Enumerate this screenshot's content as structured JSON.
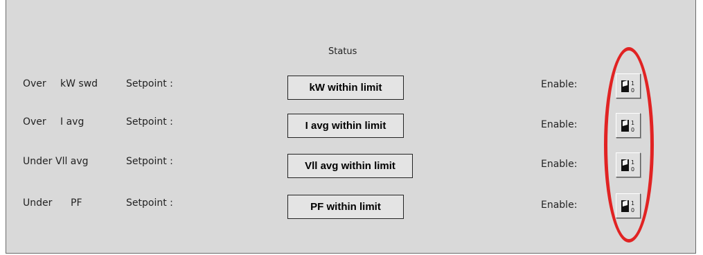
{
  "status_header": "Status",
  "rows": [
    {
      "type": "Over",
      "param": "kW swd",
      "setpoint_label": "Setpoint :",
      "status": "kW within limit",
      "enable_label": "Enable:"
    },
    {
      "type": "Over",
      "param": "I avg",
      "setpoint_label": "Setpoint :",
      "status": "I avg within limit",
      "enable_label": "Enable:"
    },
    {
      "type": "Under",
      "param": "Vll avg",
      "setpoint_label": "Setpoint :",
      "status": "Vll avg within limit",
      "enable_label": "Enable:"
    },
    {
      "type": "Under",
      "param": "PF",
      "setpoint_label": "Setpoint :",
      "status": "PF within limit",
      "enable_label": "Enable:"
    }
  ],
  "toggle_icon": "switch-1-0-icon",
  "colors": {
    "panel": "#d9d9d9",
    "highlight": "#e12323"
  }
}
